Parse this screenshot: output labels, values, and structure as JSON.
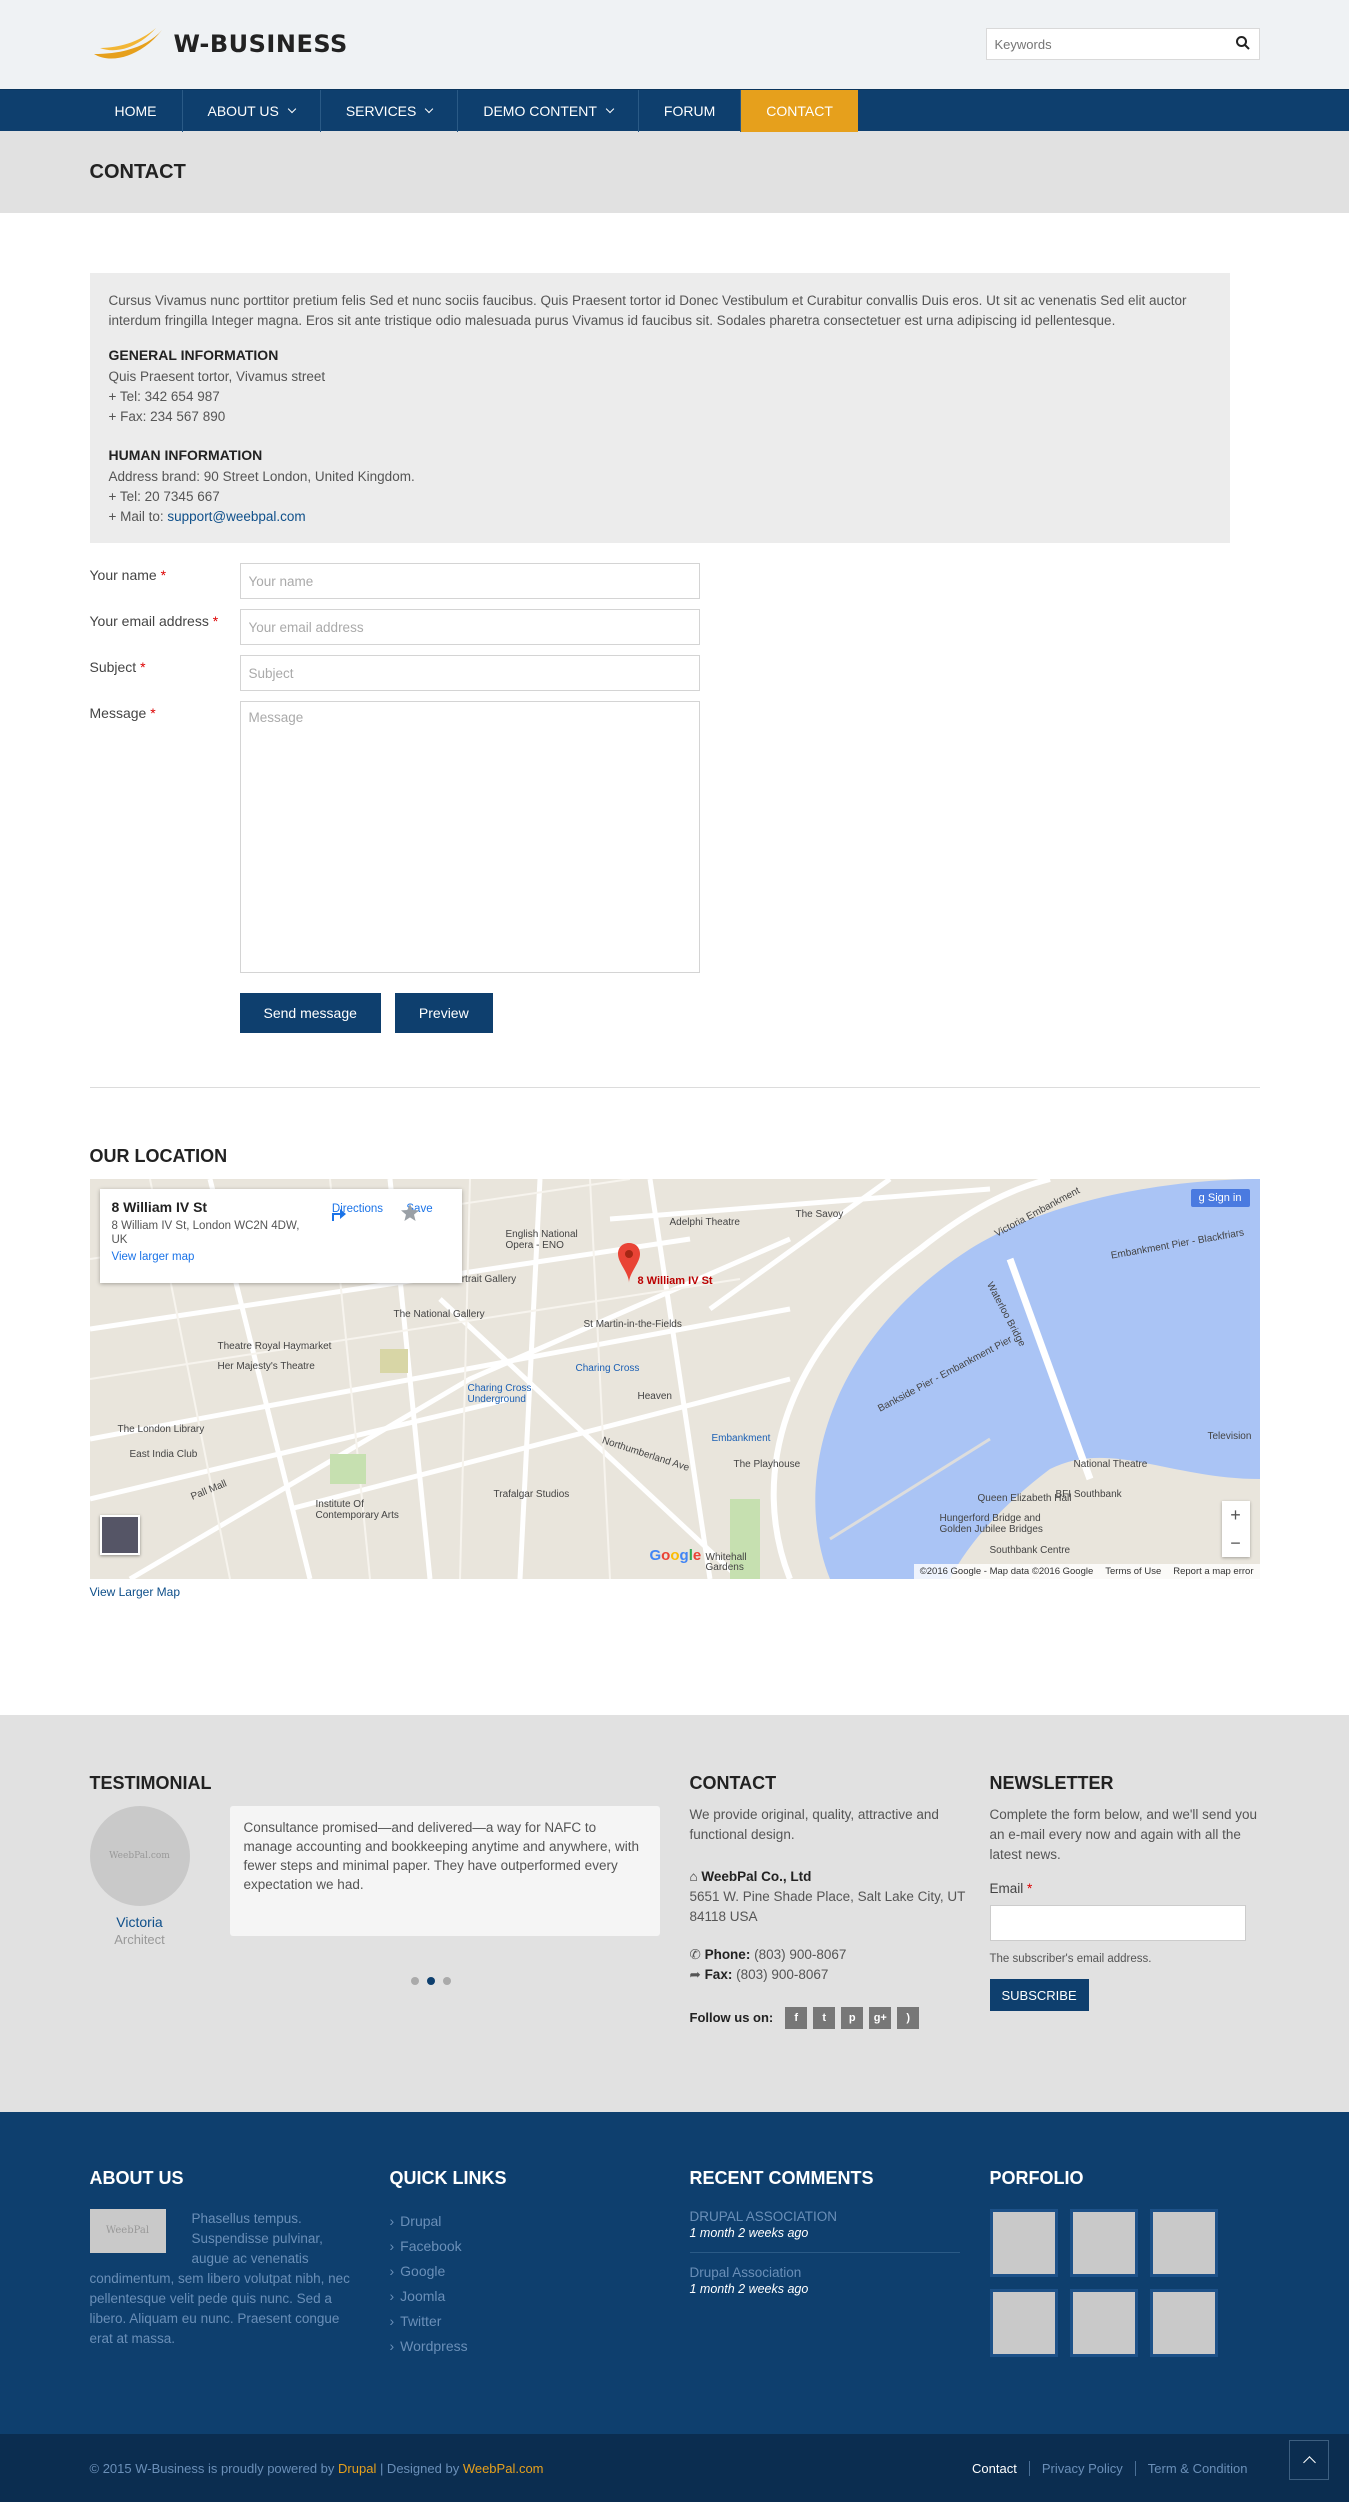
{
  "brand": {
    "name": "W-BUSINESS"
  },
  "search": {
    "placeholder": "Keywords"
  },
  "nav": [
    {
      "label": "HOME",
      "caret": false
    },
    {
      "label": "ABOUT US",
      "caret": true
    },
    {
      "label": "SERVICES",
      "caret": true
    },
    {
      "label": "DEMO CONTENT",
      "caret": true
    },
    {
      "label": "FORUM",
      "caret": false
    },
    {
      "label": "CONTACT",
      "caret": false,
      "active": true
    }
  ],
  "page": {
    "title": "CONTACT"
  },
  "info": {
    "intro": "Cursus Vivamus nunc porttitor pretium felis Sed et nunc sociis faucibus. Quis Praesent tortor id Donec Vestibulum et Curabitur convallis Duis eros. Ut sit ac venenatis Sed elit auctor interdum fringilla Integer magna. Eros sit ante tristique odio malesuada purus Vivamus id faucibus sit. Sodales pharetra consectetuer est urna adipiscing id pellentesque.",
    "general_title": "GENERAL INFORMATION",
    "general_line1": "Quis Praesent tortor, Vivamus street",
    "general_tel": "+ Tel: 342 654 987",
    "general_fax": "+ Fax: 234 567 890",
    "human_title": "HUMAN INFORMATION",
    "human_address": "Address brand: 90 Street London, United Kingdom.",
    "human_tel": "+ Tel: 20 7345 667",
    "human_mail_prefix": "+ Mail to: ",
    "human_mail": "support@weebpal.com"
  },
  "form": {
    "name_label": "Your name",
    "name_placeholder": "Your name",
    "email_label": "Your email address",
    "email_placeholder": "Your email address",
    "subject_label": "Subject",
    "subject_placeholder": "Subject",
    "message_label": "Message",
    "message_placeholder": "Message",
    "required_mark": "*",
    "send_label": "Send message",
    "preview_label": "Preview"
  },
  "location": {
    "title": "OUR LOCATION",
    "card_title": "8 William IV St",
    "card_address": "8 William IV St, London WC2N 4DW, UK",
    "card_link": "View larger map",
    "directions": "Directions",
    "save": "Save",
    "signin": "Sign in",
    "pin_label": "8 William IV St",
    "attribution": "©2016 Google - Map data ©2016 Google",
    "terms": "Terms of Use",
    "report": "Report a map error",
    "google": "Google",
    "view_larger": "View Larger Map",
    "labels": {
      "savoy": "The Savoy",
      "adelphi": "Adelphi Theatre",
      "eno": "English National Opera - ENO",
      "portrait": "Portrait Gallery",
      "national_gallery": "The National Gallery",
      "st_martin": "St Martin-in-the-Fields",
      "charing_cross": "Charing Cross",
      "charing_cross_ug": "Charing Cross Underground",
      "theatre_royal": "Theatre Royal Haymarket",
      "her_majesty": "Her Majesty's Theatre",
      "london_library": "The London Library",
      "east_india": "East India Club",
      "heaven": "Heaven",
      "embankment": "Embankment",
      "playhouse": "The Playhouse",
      "trafalgar_studios": "Trafalgar Studios",
      "ica": "Institute Of Contemporary Arts",
      "queen_elizabeth": "Queen Elizabeth Hall",
      "bfi": "BFI Southbank",
      "national_theatre": "National Theatre",
      "hungerford": "Hungerford Bridge and Golden Jubilee Bridges",
      "southbank": "Southbank Centre",
      "television": "Television",
      "whitehall": "Whitehall Gardens",
      "waterloo_bridge": "Waterloo Bridge",
      "victoria_emb": "Victoria Embankment",
      "pall_mall": "Pall Mall",
      "northumberland": "Northumberland Ave",
      "bankside": "Bankside Pier - Embankment Pier",
      "blackfriars": "Embankment Pier - Blackfriars"
    }
  },
  "testimonial": {
    "title": "TESTIMONIAL",
    "avatar_text": "WeebPal.com",
    "quote": "Consultance promised—and delivered—a way for NAFC to manage accounting and bookkeeping anytime and anywhere, with fewer steps and minimal paper. They have outperformed every expectation we had.",
    "name": "Victoria",
    "role": "Architect"
  },
  "footer_contact": {
    "title": "CONTACT",
    "desc": "We provide original, quality, attractive and functional design.",
    "company": "WeebPal Co., Ltd",
    "address": "5651 W. Pine Shade Place, Salt Lake City, UT 84118 USA",
    "phone_label": "Phone:",
    "phone": "(803) 900-8067",
    "fax_label": "Fax:",
    "fax": "(803) 900-8067",
    "follow": "Follow us on:"
  },
  "newsletter": {
    "title": "NEWSLETTER",
    "desc": "Complete the form below, and we'll send you an e-mail every now and again with all the latest news.",
    "email_label": "Email",
    "hint": "The subscriber's email address.",
    "button": "SUBSCRIBE"
  },
  "about": {
    "title": "ABOUT US",
    "img_text": "WeebPal",
    "text": "Phasellus tempus. Suspendisse pulvinar, augue ac venenatis condimentum, sem libero volutpat nibh, nec pellentesque velit pede quis nunc. Sed a libero. Aliquam eu nunc. Praesent congue erat at massa."
  },
  "quick_links": {
    "title": "QUICK LINKS",
    "items": [
      "Drupal",
      "Facebook",
      "Google",
      "Joomla",
      "Twitter",
      "Wordpress"
    ]
  },
  "recent_comments": {
    "title": "RECENT COMMENTS",
    "items": [
      {
        "title": "DRUPAL ASSOCIATION",
        "time": "1 month 2 weeks ago"
      },
      {
        "title": "Drupal Association",
        "time": "1 month 2 weeks ago"
      }
    ]
  },
  "portfolio": {
    "title": "PORFOLIO"
  },
  "copyright": {
    "prefix": "© 2015 W-Business is proudly powered by ",
    "drupal": "Drupal",
    "mid": " | Designed by ",
    "weebpal": "WeebPal.com",
    "links": [
      "Contact",
      "Privacy Policy",
      "Term & Condition"
    ]
  },
  "colors": {
    "primary": "#0e3f6e",
    "accent": "#e6a01c",
    "water": "#aac4f5"
  }
}
